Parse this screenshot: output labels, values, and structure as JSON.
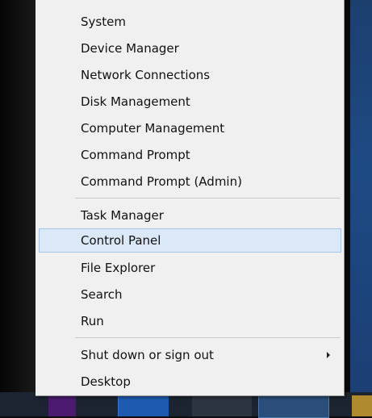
{
  "menu": {
    "group1": [
      {
        "label": "System"
      },
      {
        "label": "Device Manager"
      },
      {
        "label": "Network Connections"
      },
      {
        "label": "Disk Management"
      },
      {
        "label": "Computer Management"
      },
      {
        "label": "Command Prompt"
      },
      {
        "label": "Command Prompt (Admin)"
      }
    ],
    "group2": [
      {
        "label": "Task Manager"
      },
      {
        "label": "Control Panel",
        "selected": true
      },
      {
        "label": "File Explorer"
      },
      {
        "label": "Search"
      },
      {
        "label": "Run"
      }
    ],
    "group3": [
      {
        "label": "Shut down or sign out",
        "has_submenu": true
      },
      {
        "label": "Desktop"
      }
    ]
  },
  "colors": {
    "menu_background": "#f0f0f0",
    "highlight": "#dbe8f8",
    "highlight_border": "#a7c4ea",
    "text": "#111111"
  }
}
